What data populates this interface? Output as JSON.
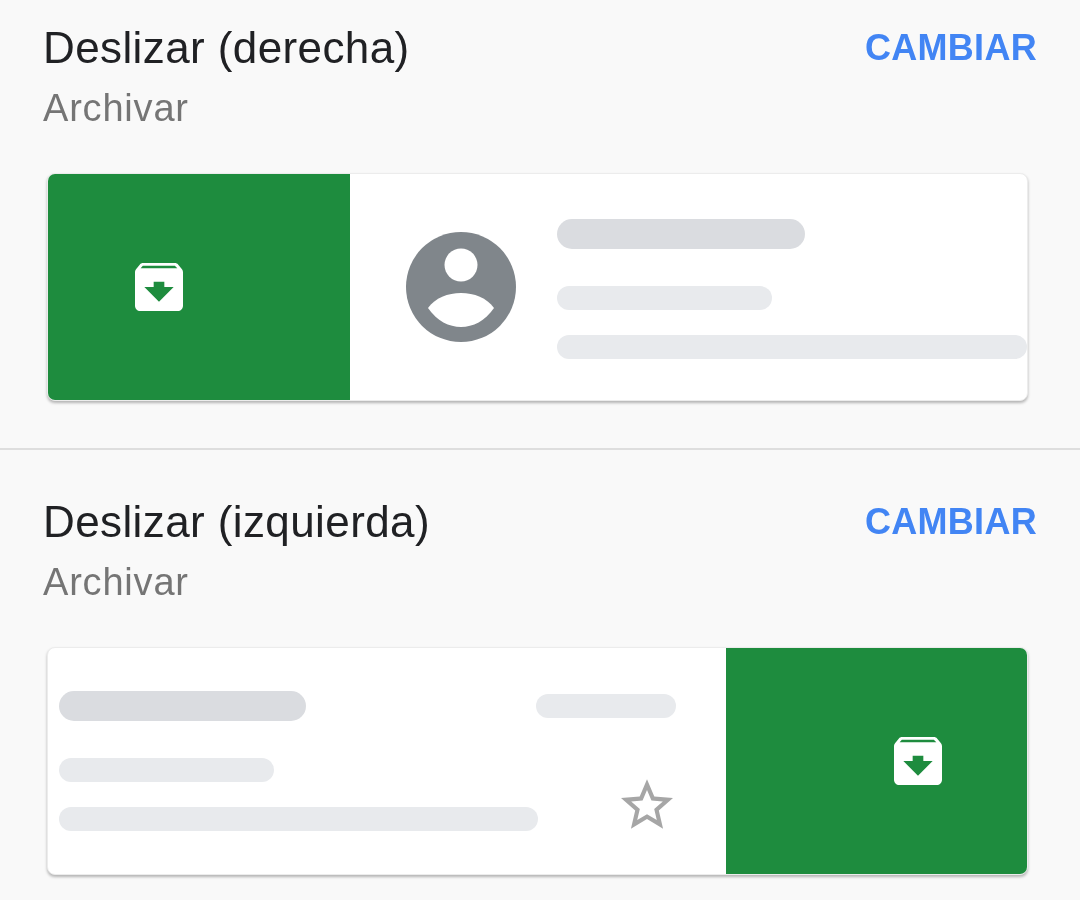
{
  "sections": [
    {
      "title": "Deslizar (derecha)",
      "action": "Archivar",
      "button": "CAMBIAR",
      "preview": {
        "kind": "swipe_right"
      }
    },
    {
      "title": "Deslizar (izquierda)",
      "action": "Archivar",
      "button": "CAMBIAR",
      "preview": {
        "kind": "swipe_left"
      }
    }
  ]
}
